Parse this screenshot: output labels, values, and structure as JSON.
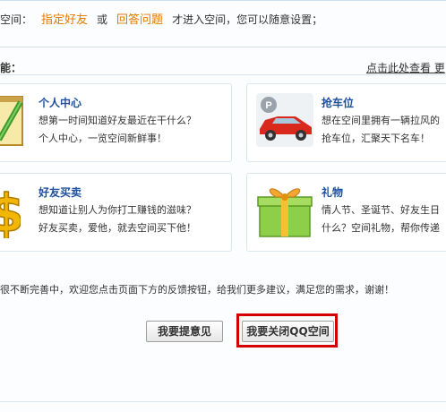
{
  "privacy": {
    "prefix": "空间：",
    "option1": "指定好友",
    "or": "或",
    "option2": "回答问题",
    "suffix": "才进入空间，您可以随意设置；"
  },
  "functions": {
    "heading": "能：",
    "view_more": "点击此处查看 更"
  },
  "cards": [
    {
      "title": "个人中心",
      "line1": "想第一时间知道好友最近在干什么？",
      "line2": "个人中心，一览空间新鲜事！",
      "icon": "notepad-pencil-icon"
    },
    {
      "title": "抢车位",
      "line1": "想在空间里拥有一辆拉风的",
      "line2": "抢车位，汇聚天下名车！",
      "icon": "parking-car-icon"
    },
    {
      "title": "好友买卖",
      "line1": "想知道让别人为你打工赚钱的滋味？",
      "line2": "好友买卖，爱他，就去空间买下他！",
      "icon": "dollar-sign-icon"
    },
    {
      "title": "礼物",
      "line1": "情人节、圣诞节、好友生日",
      "line2": "什么？空间礼物，帮你传递",
      "icon": "gift-box-icon"
    }
  ],
  "notice": "很不断完善中，欢迎您点击页面下方的反馈按钮，给我们更多建议，满足您的需求，谢谢！",
  "buttons": {
    "feedback": "我要提意见",
    "close_space": "我要关闭QQ空间"
  },
  "colors": {
    "highlight": "#e07b00",
    "title_blue": "#1d4f9c",
    "red_box": "#d40000"
  }
}
